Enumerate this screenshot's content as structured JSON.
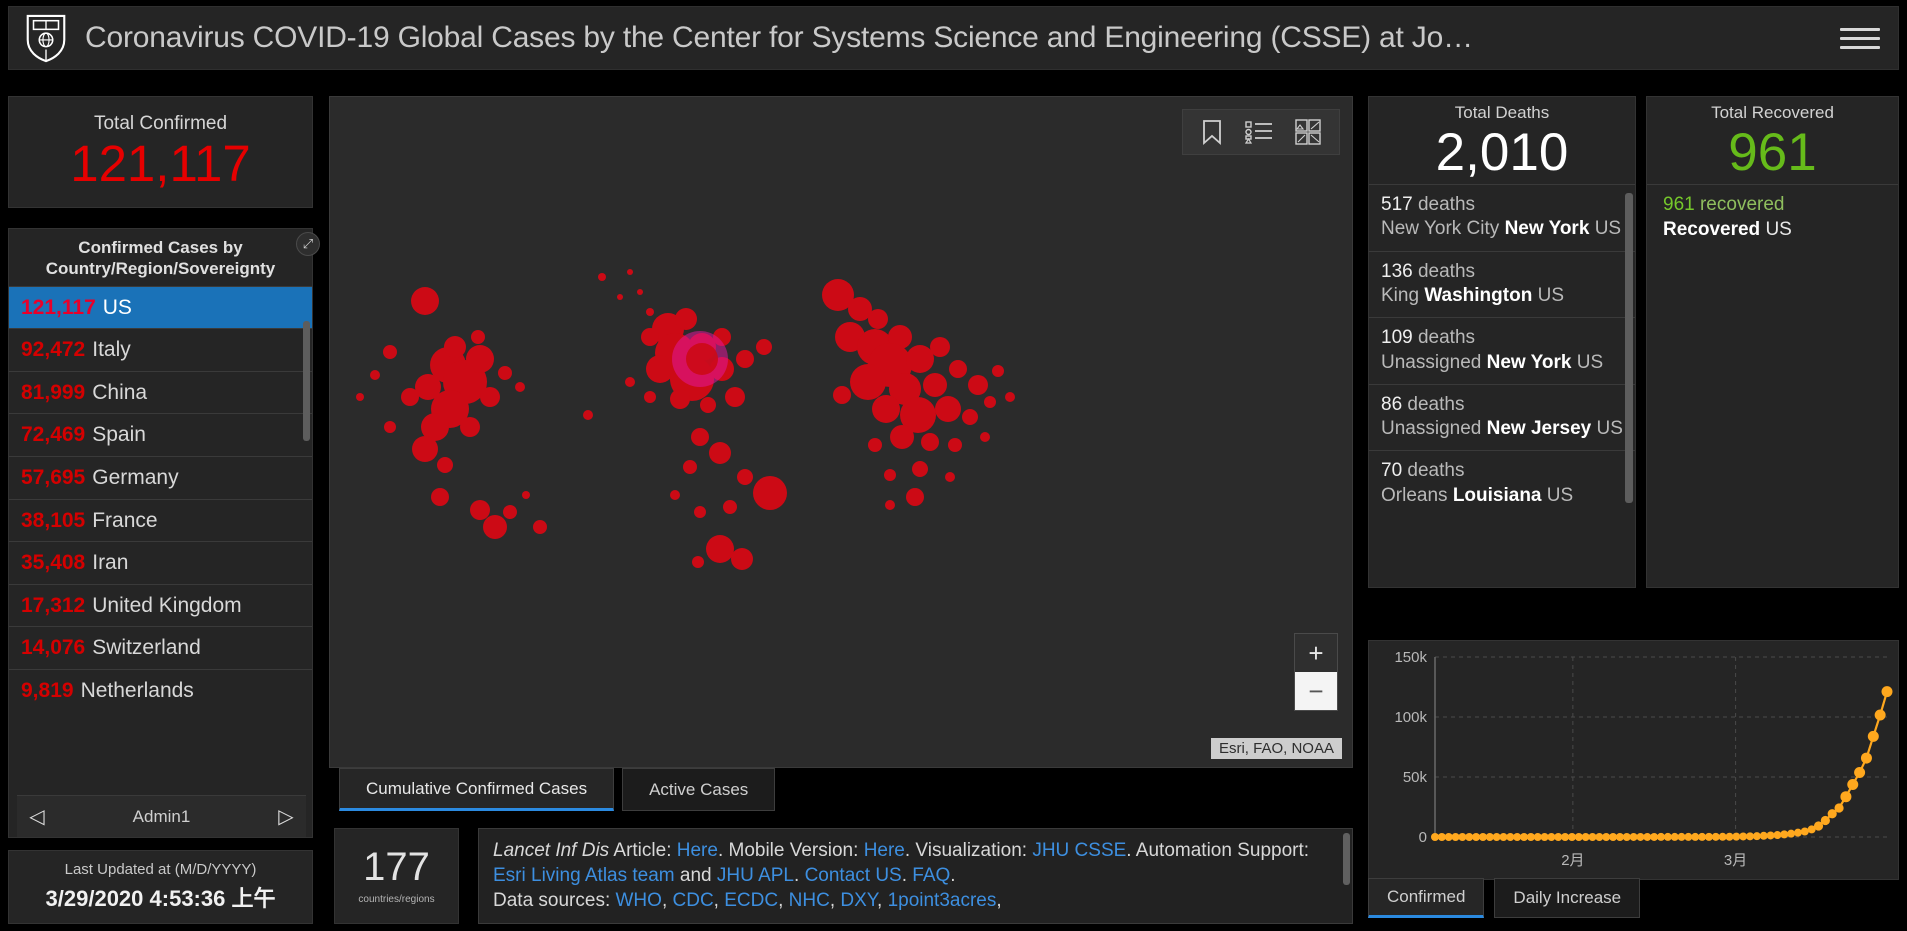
{
  "header": {
    "title": "Coronavirus COVID-19 Global Cases by the Center for Systems Science and Engineering (CSSE) at Jo…",
    "logo_name": "jhu-shield-logo",
    "menu_icon": "hamburger-menu-icon"
  },
  "total_confirmed": {
    "label": "Total Confirmed",
    "value": "121,117",
    "color": "#e60000"
  },
  "country_panel": {
    "title": "Confirmed Cases by Country/Region/Sovereignty",
    "rows": [
      {
        "count": "121,117",
        "name": "US",
        "selected": true
      },
      {
        "count": "92,472",
        "name": "Italy",
        "selected": false
      },
      {
        "count": "81,999",
        "name": "China",
        "selected": false
      },
      {
        "count": "72,469",
        "name": "Spain",
        "selected": false
      },
      {
        "count": "57,695",
        "name": "Germany",
        "selected": false
      },
      {
        "count": "38,105",
        "name": "France",
        "selected": false
      },
      {
        "count": "35,408",
        "name": "Iran",
        "selected": false
      },
      {
        "count": "17,312",
        "name": "United Kingdom",
        "selected": false
      },
      {
        "count": "14,076",
        "name": "Switzerland",
        "selected": false
      },
      {
        "count": "9,819",
        "name": "Netherlands",
        "selected": false
      }
    ],
    "pager": {
      "prev": "◁",
      "label": "Admin1",
      "next": "▷"
    }
  },
  "last_updated": {
    "label": "Last Updated at (M/D/YYYY)",
    "value": "3/29/2020 4:53:36 上午"
  },
  "map": {
    "tools": [
      "bookmark-icon",
      "legend-list-icon",
      "basemap-gallery-icon"
    ],
    "zoom_in": "+",
    "zoom_out": "−",
    "attribution": "Esri, FAO, NOAA",
    "tabs": [
      {
        "label": "Cumulative Confirmed Cases",
        "active": true
      },
      {
        "label": "Active Cases",
        "active": false
      }
    ]
  },
  "deaths": {
    "title": "Total Deaths",
    "value": "2,010",
    "rows": [
      {
        "count": "517",
        "unit": "deaths",
        "place": "New York City",
        "region": "New York",
        "country": "US"
      },
      {
        "count": "136",
        "unit": "deaths",
        "place": "King",
        "region": "Washington",
        "country": "US"
      },
      {
        "count": "109",
        "unit": "deaths",
        "place": "Unassigned",
        "region": "New York",
        "country": "US"
      },
      {
        "count": "86",
        "unit": "deaths",
        "place": "Unassigned",
        "region": "New Jersey",
        "country": "US"
      },
      {
        "count": "70",
        "unit": "deaths",
        "place": "Orleans",
        "region": "Louisiana",
        "country": "US"
      }
    ]
  },
  "recovered": {
    "title": "Total Recovered",
    "value": "961",
    "color": "#66bb1a",
    "rows": [
      {
        "count": "961",
        "unit": "recovered",
        "place": "Recovered",
        "country": "US"
      }
    ]
  },
  "countries_box": {
    "value": "177",
    "label": "countries/regions"
  },
  "credits": {
    "line1_pre_em": "Lancet Inf Dis",
    "line1": " Article: ",
    "link_here1": "Here",
    "mobile_label": ". Mobile Version: ",
    "link_here2": "Here",
    "viz_label": ". Visualization: ",
    "link_jhu_csse": "JHU CSSE",
    "automation": ". Automation Support: ",
    "link_esri": "Esri Living Atlas team",
    "and": " and ",
    "link_jhu_apl": "JHU APL",
    "dot1": ". ",
    "link_contact": "Contact US",
    "dot2": ". ",
    "link_faq": "FAQ",
    "dot3": ".",
    "datasources_label": "Data sources: ",
    "sources": [
      "WHO",
      "CDC",
      "ECDC",
      "NHC",
      "DXY",
      "1point3acres"
    ],
    "trailing": ","
  },
  "chart_data": {
    "type": "line",
    "title": "",
    "xlabel": "",
    "ylabel": "",
    "ylim": [
      0,
      150000
    ],
    "ytick_labels": [
      "0",
      "50k",
      "100k",
      "150k"
    ],
    "ytick_values": [
      0,
      50000,
      100000,
      150000
    ],
    "xtick_labels": [
      "2月",
      "3月"
    ],
    "grid": true,
    "series_color": "#ffa81e",
    "marker": "circle",
    "series": [
      {
        "name": "Confirmed",
        "x": [
          "1/22",
          "1/23",
          "1/24",
          "1/25",
          "1/26",
          "1/27",
          "1/28",
          "1/29",
          "1/30",
          "1/31",
          "2/1",
          "2/2",
          "2/3",
          "2/4",
          "2/5",
          "2/6",
          "2/7",
          "2/8",
          "2/9",
          "2/10",
          "2/11",
          "2/12",
          "2/13",
          "2/14",
          "2/15",
          "2/16",
          "2/17",
          "2/18",
          "2/19",
          "2/20",
          "2/21",
          "2/22",
          "2/23",
          "2/24",
          "2/25",
          "2/26",
          "2/27",
          "2/28",
          "2/29",
          "3/1",
          "3/2",
          "3/3",
          "3/4",
          "3/5",
          "3/6",
          "3/7",
          "3/8",
          "3/9",
          "3/10",
          "3/11",
          "3/12",
          "3/13",
          "3/14",
          "3/15",
          "3/16",
          "3/17",
          "3/18",
          "3/19",
          "3/20",
          "3/21",
          "3/22",
          "3/23",
          "3/24",
          "3/25",
          "3/26",
          "3/27",
          "3/28",
          "3/29"
        ],
        "values": [
          1,
          1,
          2,
          2,
          5,
          5,
          5,
          5,
          5,
          7,
          8,
          8,
          11,
          11,
          11,
          11,
          11,
          11,
          11,
          11,
          12,
          12,
          13,
          13,
          13,
          13,
          13,
          13,
          13,
          15,
          15,
          15,
          35,
          53,
          57,
          60,
          62,
          65,
          70,
          89,
          105,
          125,
          159,
          221,
          319,
          435,
          541,
          704,
          994,
          1301,
          1630,
          2183,
          2770,
          3613,
          4596,
          6344,
          9197,
          13779,
          19367,
          24192,
          33592,
          43781,
          53740,
          65778,
          83836,
          101657,
          121117
        ]
      }
    ],
    "tabs": [
      {
        "label": "Confirmed",
        "active": true
      },
      {
        "label": "Daily Increase",
        "active": false
      }
    ]
  }
}
